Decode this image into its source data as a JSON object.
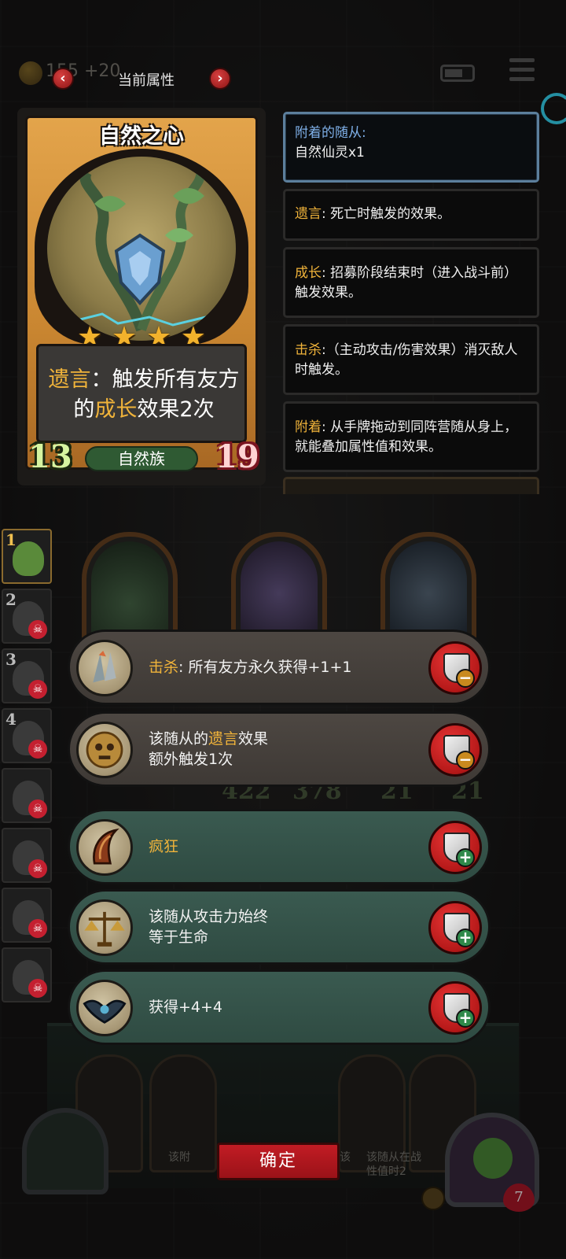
{
  "topbar": {
    "coin_text": "155 +20",
    "title": "当前属性",
    "prev_label": "‹",
    "next_label": "›"
  },
  "card": {
    "name": "自然之心",
    "stars": 4,
    "desc_kw1": "遗言",
    "desc_part1": "：触发所有友方的",
    "desc_kw2": "成长",
    "desc_part2": "效果2次",
    "attack": "13",
    "health": "19",
    "tribe": "自然族"
  },
  "info": [
    {
      "label": "附着的随从:",
      "text": "自然仙灵x1"
    },
    {
      "kw": "遗言",
      "text": ": 死亡时触发的效果。"
    },
    {
      "kw": "成长",
      "text": ": 招募阶段结束时（进入战斗前）触发效果。"
    },
    {
      "kw": "击杀",
      "text": ":（主动攻击/伤害效果）消灭敌人时触发。"
    },
    {
      "kw": "附着",
      "text": ": 从手牌拖动到同阵营随从身上，就能叠加属性值和效果。"
    }
  ],
  "roster": [
    "1",
    "2",
    "3",
    "4"
  ],
  "options": [
    {
      "kw": "击杀",
      "text": ": 所有友方永久获得+1+1",
      "action": "minus"
    },
    {
      "pre": "该随从的",
      "kw": "遗言",
      "text": "效果",
      "line2": "额外触发1次",
      "action": "minus"
    },
    {
      "text": "疯狂",
      "action": "plus"
    },
    {
      "text": "该随从攻击力始终",
      "line2": "等于生命",
      "action": "plus"
    },
    {
      "text": "获得+4+4",
      "action": "plus"
    }
  ],
  "board_stats": [
    "422",
    "378",
    "21",
    "21"
  ],
  "hand_text": [
    "该附",
    "该",
    "该随从在战",
    "性值时2"
  ],
  "confirm_label": "确定",
  "player_hp": "7",
  "colors": {
    "accent_gold": "#f0b33a",
    "button_red": "#c21c24",
    "info_blue": "#7fb0e8"
  }
}
